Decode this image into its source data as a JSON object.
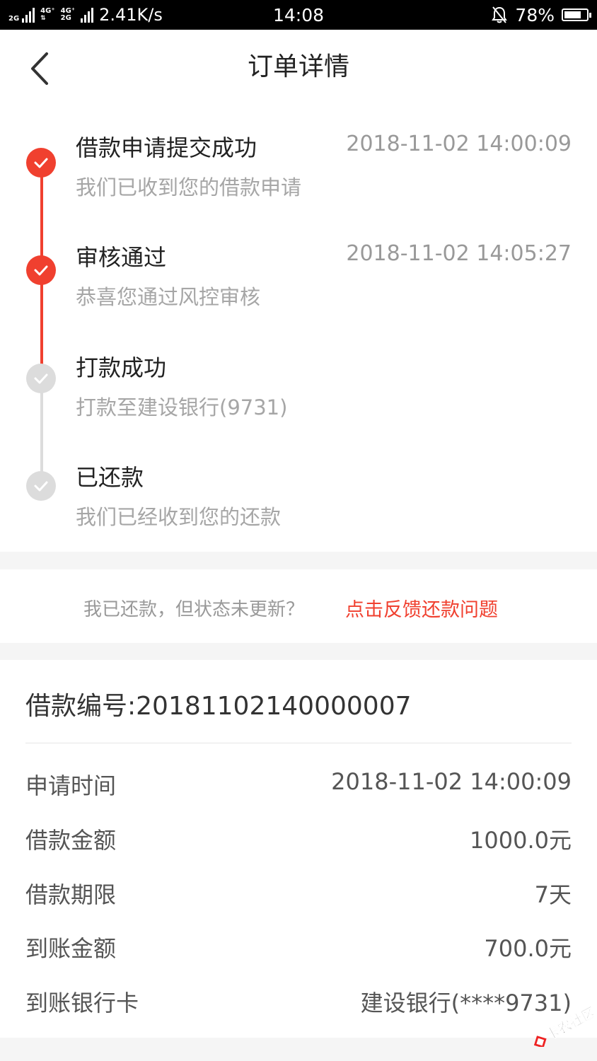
{
  "status_bar": {
    "net1": "2G",
    "net2a": "4G⁺",
    "net2b": "4G⁺",
    "net2c": "2G",
    "speed": "2.41K/s",
    "time": "14:08",
    "battery": "78%",
    "battery_level": 0.78
  },
  "header": {
    "title": "订单详情"
  },
  "timeline": {
    "steps": [
      {
        "title": "借款申请提交成功",
        "time": "2018-11-02 14:00:09",
        "desc": "我们已收到您的借款申请",
        "done": true
      },
      {
        "title": "审核通过",
        "time": "2018-11-02 14:05:27",
        "desc": "恭喜您通过风控审核",
        "done": true
      },
      {
        "title": "打款成功",
        "time": "",
        "desc": "打款至建设银行(9731)",
        "done": false
      },
      {
        "title": "已还款",
        "time": "",
        "desc": "我们已经收到您的还款",
        "done": false
      }
    ]
  },
  "feedback": {
    "question": "我已还款，但状态未更新？",
    "link": "点击反馈还款问题"
  },
  "details": {
    "loan_no": "借款编号:20181102140000007",
    "rows": [
      {
        "label": "申请时间",
        "value": "2018-11-02 14:00:09"
      },
      {
        "label": "借款金额",
        "value": "1000.0元"
      },
      {
        "label": "借款期限",
        "value": "7天"
      },
      {
        "label": "到账金额",
        "value": "700.0元"
      },
      {
        "label": "到账银行卡",
        "value": "建设银行(****9731)"
      }
    ]
  },
  "watermark": {
    "text": "卡农社区"
  },
  "colors": {
    "accent": "#f0402f",
    "inactive": "#dcdcdc"
  }
}
